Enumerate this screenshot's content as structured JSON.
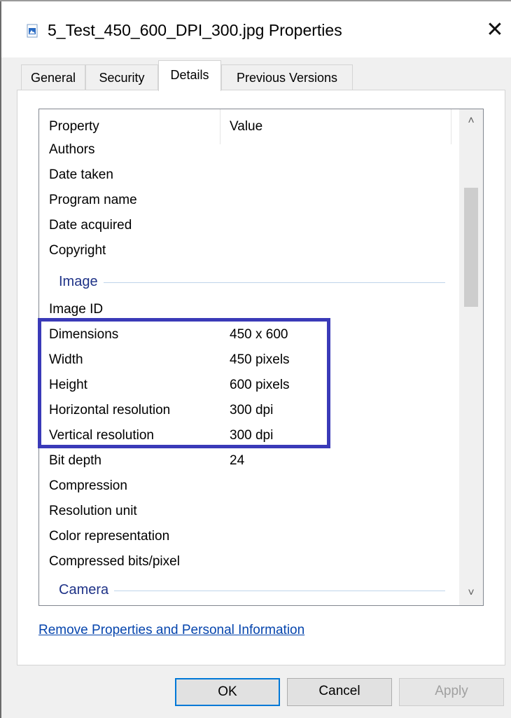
{
  "window": {
    "title": "5_Test_450_600_DPI_300.jpg Properties",
    "close_glyph": "✕"
  },
  "tabs": [
    {
      "label": "General"
    },
    {
      "label": "Security"
    },
    {
      "label": "Details",
      "active": true
    },
    {
      "label": "Previous Versions"
    }
  ],
  "details": {
    "columns": {
      "property": "Property",
      "value": "Value"
    },
    "rows_top": [
      {
        "name": "Authors",
        "value": ""
      },
      {
        "name": "Date taken",
        "value": ""
      },
      {
        "name": "Program name",
        "value": ""
      },
      {
        "name": "Date acquired",
        "value": ""
      },
      {
        "name": "Copyright",
        "value": ""
      }
    ],
    "group_image": "Image",
    "rows_image": [
      {
        "name": "Image ID",
        "value": ""
      },
      {
        "name": "Dimensions",
        "value": "450 x 600"
      },
      {
        "name": "Width",
        "value": "450 pixels"
      },
      {
        "name": "Height",
        "value": "600 pixels"
      },
      {
        "name": "Horizontal resolution",
        "value": "300 dpi"
      },
      {
        "name": "Vertical resolution",
        "value": "300 dpi"
      },
      {
        "name": "Bit depth",
        "value": "24"
      },
      {
        "name": "Compression",
        "value": ""
      },
      {
        "name": "Resolution unit",
        "value": ""
      },
      {
        "name": "Color representation",
        "value": ""
      },
      {
        "name": "Compressed bits/pixel",
        "value": ""
      }
    ],
    "group_camera": "Camera",
    "scroll_up_glyph": "˄",
    "scroll_down_glyph": "˅"
  },
  "link": "Remove Properties and Personal Information",
  "buttons": {
    "ok": "OK",
    "cancel": "Cancel",
    "apply": "Apply"
  },
  "colors": {
    "highlight": "#3a3ab8",
    "group_text": "#1e3287",
    "link": "#0645ad"
  }
}
